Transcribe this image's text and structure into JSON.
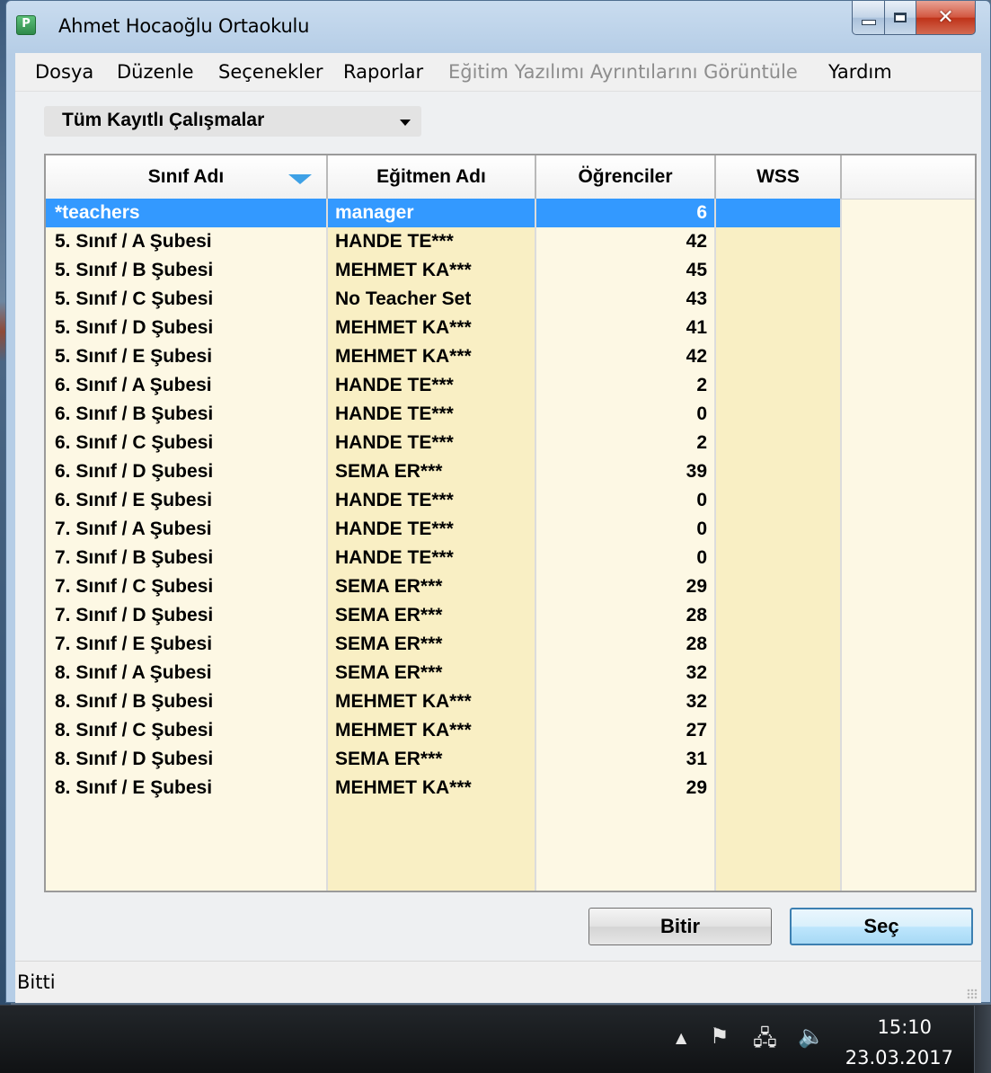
{
  "window": {
    "title": "Ahmet Hocaoğlu Ortaokulu",
    "icon_letter": "P"
  },
  "menu": [
    {
      "label": "Dosya",
      "enabled": true
    },
    {
      "label": "Düzenle",
      "enabled": true
    },
    {
      "label": "Seçenekler",
      "enabled": true
    },
    {
      "label": "Raporlar",
      "enabled": true
    },
    {
      "label": "Eğitim Yazılımı Ayrıntılarını Görüntüle",
      "enabled": false
    },
    {
      "label": "Yardım",
      "enabled": true
    }
  ],
  "studies_filter": {
    "selected": "Tüm Kayıtlı Çalışmalar"
  },
  "table": {
    "columns": [
      "Sınıf Adı",
      "Eğitmen Adı",
      "Öğrenciler",
      "WSS"
    ],
    "sorted_column": "Sınıf Adı",
    "rows": [
      {
        "class": "*teachers",
        "teacher": "manager",
        "students": "6",
        "wss": "",
        "selected": true
      },
      {
        "class": "5. Sınıf / A Şubesi",
        "teacher": "HANDE TE***",
        "students": "42",
        "wss": ""
      },
      {
        "class": "5. Sınıf / B Şubesi",
        "teacher": "MEHMET KA***",
        "students": "45",
        "wss": ""
      },
      {
        "class": "5. Sınıf / C Şubesi",
        "teacher": "No Teacher Set",
        "students": "43",
        "wss": ""
      },
      {
        "class": "5. Sınıf / D Şubesi",
        "teacher": "MEHMET KA***",
        "students": "41",
        "wss": ""
      },
      {
        "class": "5. Sınıf / E Şubesi",
        "teacher": "MEHMET KA***",
        "students": "42",
        "wss": ""
      },
      {
        "class": "6. Sınıf / A Şubesi",
        "teacher": "HANDE TE***",
        "students": "2",
        "wss": ""
      },
      {
        "class": "6. Sınıf / B Şubesi",
        "teacher": "HANDE TE***",
        "students": "0",
        "wss": ""
      },
      {
        "class": "6. Sınıf / C Şubesi",
        "teacher": "HANDE TE***",
        "students": "2",
        "wss": ""
      },
      {
        "class": "6. Sınıf / D Şubesi",
        "teacher": "SEMA ER***",
        "students": "39",
        "wss": ""
      },
      {
        "class": "6. Sınıf / E Şubesi",
        "teacher": "HANDE TE***",
        "students": "0",
        "wss": ""
      },
      {
        "class": "7. Sınıf / A Şubesi",
        "teacher": "HANDE TE***",
        "students": "0",
        "wss": ""
      },
      {
        "class": "7. Sınıf / B Şubesi",
        "teacher": "HANDE TE***",
        "students": "0",
        "wss": ""
      },
      {
        "class": "7. Sınıf / C Şubesi",
        "teacher": "SEMA ER***",
        "students": "29",
        "wss": ""
      },
      {
        "class": "7. Sınıf / D Şubesi",
        "teacher": "SEMA ER***",
        "students": "28",
        "wss": ""
      },
      {
        "class": "7. Sınıf / E Şubesi",
        "teacher": "SEMA ER***",
        "students": "28",
        "wss": ""
      },
      {
        "class": "8. Sınıf / A Şubesi",
        "teacher": "SEMA ER***",
        "students": "32",
        "wss": ""
      },
      {
        "class": "8. Sınıf / B Şubesi",
        "teacher": "MEHMET KA***",
        "students": "32",
        "wss": ""
      },
      {
        "class": "8. Sınıf / C Şubesi",
        "teacher": "MEHMET KA***",
        "students": "27",
        "wss": ""
      },
      {
        "class": "8. Sınıf / D Şubesi",
        "teacher": "SEMA ER***",
        "students": "31",
        "wss": ""
      },
      {
        "class": "8. Sınıf / E Şubesi",
        "teacher": "MEHMET KA***",
        "students": "29",
        "wss": ""
      }
    ]
  },
  "buttons": {
    "finish": "Bitir",
    "select": "Seç"
  },
  "status": {
    "text": "Bitti"
  },
  "taskbar": {
    "time": "15:10",
    "date": "23.03.2017",
    "tray_icons": [
      "show-hidden-icons-arrow",
      "action-center-flag",
      "network",
      "volume"
    ]
  },
  "colors": {
    "selection": "#3399ff",
    "sort_arrow": "#3ea1e6",
    "row_bg": "#fdf8e4",
    "alt_col_bg": "#f9efc4"
  }
}
